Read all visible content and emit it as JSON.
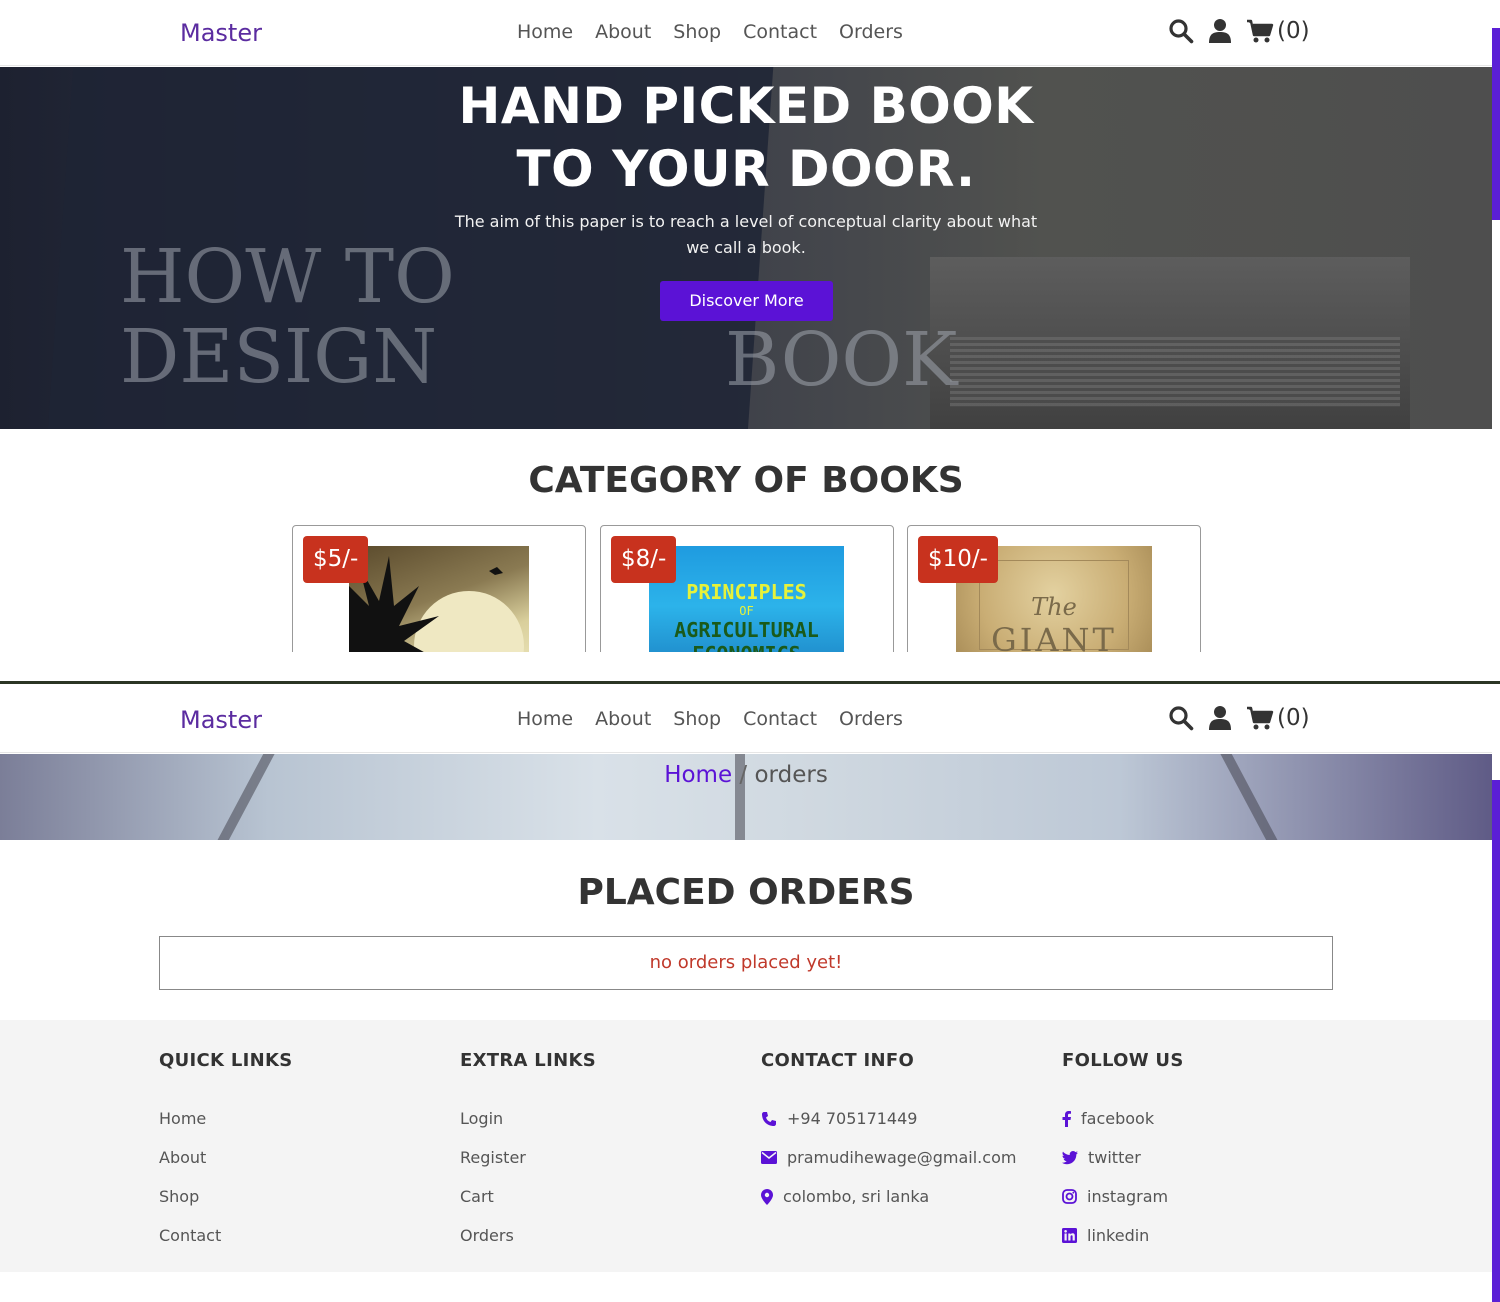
{
  "brand": {
    "accent": "#5b12d6",
    "logo_color": "#5b2ca0",
    "price_tag_color": "#c8321e",
    "error_color": "#c0392b"
  },
  "header": {
    "logo": "Master",
    "nav": [
      "Home",
      "About",
      "Shop",
      "Contact",
      "Orders"
    ],
    "icons": [
      "search-icon",
      "user-icon",
      "cart-icon"
    ],
    "cart_count": "(0)"
  },
  "hero": {
    "title_line1": "HAND PICKED BOOK",
    "title_line2": "TO YOUR DOOR.",
    "description": "The aim of this paper is to reach a level of conceptual clarity about what we call a book.",
    "button": "Discover More"
  },
  "categories": {
    "title": "CATEGORY OF BOOKS",
    "cards": [
      {
        "price": "$5/-"
      },
      {
        "price": "$8/-",
        "cover_text": [
          "PRINCIPLES",
          "OF",
          "AGRICULTURAL",
          "ECONOMICS"
        ]
      },
      {
        "price": "$10/-",
        "cover_text": [
          "The",
          "GIANT"
        ]
      }
    ]
  },
  "orders_page": {
    "breadcrumb_home": "Home",
    "breadcrumb_sep": " / ",
    "breadcrumb_current": "orders",
    "title": "PLACED ORDERS",
    "empty_message": "no orders placed yet!"
  },
  "footer": {
    "quick_links": {
      "title": "QUICK LINKS",
      "items": [
        "Home",
        "About",
        "Shop",
        "Contact"
      ]
    },
    "extra_links": {
      "title": "EXTRA LINKS",
      "items": [
        "Login",
        "Register",
        "Cart",
        "Orders"
      ]
    },
    "contact_info": {
      "title": "CONTACT INFO",
      "phone": "+94 705171449",
      "email": "pramudihewage@gmail.com",
      "location": "colombo, sri lanka"
    },
    "follow_us": {
      "title": "FOLLOW US",
      "items": [
        "facebook",
        "twitter",
        "instagram",
        "linkedin"
      ]
    }
  }
}
